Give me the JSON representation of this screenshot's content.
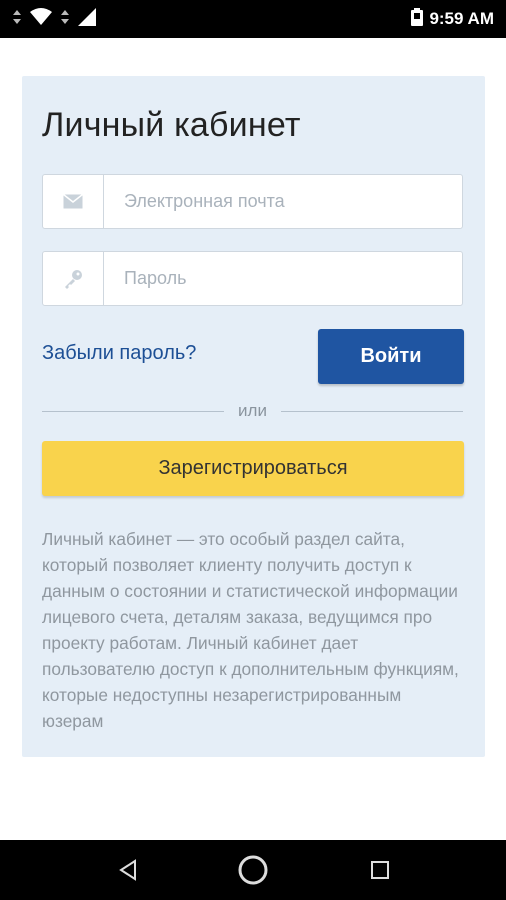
{
  "status_bar": {
    "time": "9:59 AM",
    "icons": [
      "data-arrows-icon",
      "wifi-icon",
      "data-arrows-icon",
      "signal-icon",
      "battery-icon"
    ]
  },
  "card": {
    "title": "Личный кабинет",
    "email": {
      "placeholder": "Электронная почта",
      "value": "",
      "icon": "mail-icon"
    },
    "password": {
      "placeholder": "Пароль",
      "value": "",
      "icon": "key-icon"
    },
    "forgot_link": "Забыли пароль?",
    "login_button": "Войти",
    "divider_text": "или",
    "register_button": "Зарегистрироваться",
    "description": "Личный кабинет — это особый раздел сайта, который позволяет клиенту получить доступ к данным о состоянии и статистической информации лицевого счета, деталям заказа, ведущимся про проекту работам. Личный кабинет дает пользователю доступ к дополнительным функциям, которые недоступны незарегистрированным юзерам"
  },
  "colors": {
    "card_bg": "#e5eef7",
    "primary": "#1f55a2",
    "accent_yellow": "#f9d34c",
    "link": "#1d4f95"
  },
  "nav_bar": {
    "buttons": [
      "back-icon",
      "home-icon",
      "recents-icon"
    ]
  }
}
